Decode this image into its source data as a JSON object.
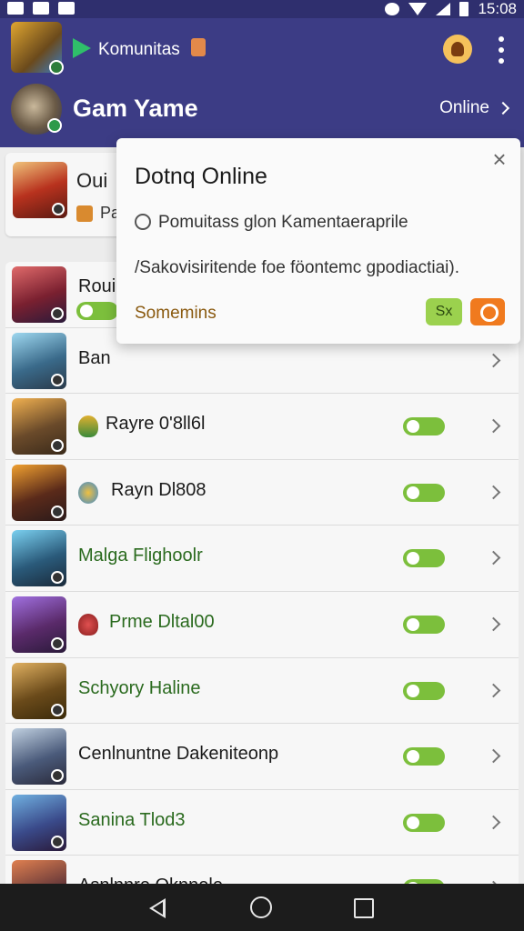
{
  "status_bar": {
    "time": "15:08"
  },
  "header": {
    "community_label": "Komunitas",
    "profile_name": "Gam Yame",
    "online_link": "Online"
  },
  "featured": {
    "title": "Oui",
    "subtitle": "Pa"
  },
  "popup": {
    "title": "Dotnq Online",
    "line1": "Pomuitass glon Kamentaeraprile",
    "line2": "/Sakovisiritende foe föontemc gpodiactiai).",
    "link": "Somemins",
    "btn_label": "Sx"
  },
  "list": {
    "rows": [
      {
        "label": "Rouir"
      },
      {
        "label": "Ban"
      },
      {
        "label": "Rayre 0'8ll6l"
      },
      {
        "label": "Rayn Dl808"
      },
      {
        "label": "Malga Flighoolr"
      },
      {
        "label": "Prme Dltal00"
      },
      {
        "label": "Schyory Haline"
      },
      {
        "label": "Cenlnuntne Dakeniteonp"
      },
      {
        "label": "Sanina Tlod3"
      },
      {
        "label": "Asnlnnre Oknnele"
      }
    ]
  },
  "colors": {
    "header_bg": "#3c3c85",
    "toggle_green": "#7cbf3c",
    "accent_orange": "#f07a1e"
  }
}
